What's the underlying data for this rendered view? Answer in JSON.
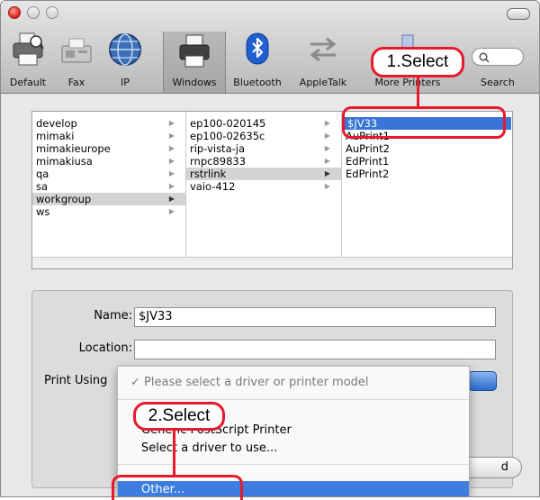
{
  "window": {
    "colors": {
      "selection": "#3875d7",
      "callout": "#e8192a",
      "menu_highlight": "#3d7ce0"
    }
  },
  "toolbar": {
    "items": [
      {
        "label": "Default",
        "icon": "printer-icon"
      },
      {
        "label": "Fax",
        "icon": "fax-icon"
      },
      {
        "label": "IP",
        "icon": "globe-icon"
      },
      {
        "label": "Windows",
        "icon": "windows-printer-icon",
        "selected": true
      },
      {
        "label": "Bluetooth",
        "icon": "bluetooth-icon"
      },
      {
        "label": "AppleTalk",
        "icon": "appletalk-arrows-icon"
      },
      {
        "label": "More Printers",
        "icon": "more-printers-icon"
      }
    ],
    "search_label": "Search"
  },
  "browser": {
    "col1": [
      "develop",
      "mimaki",
      "mimakieurope",
      "mimakiusa",
      "qa",
      "sa",
      "workgroup",
      "ws"
    ],
    "col1_selected": "workgroup",
    "col2": [
      "ep100-020145",
      "ep100-02635c",
      "rip-vista-ja",
      "rnpc89833",
      "rstrlink",
      "vaio-412"
    ],
    "col2_selected": "rstrlink",
    "col3": [
      "$JV33",
      "AuPrint1",
      "AuPrint2",
      "EdPrint1",
      "EdPrint2"
    ],
    "col3_selected": "$JV33"
  },
  "form": {
    "name_label": "Name:",
    "name_value": "$JV33",
    "location_label": "Location:",
    "location_value": "",
    "print_using_label": "Print Using"
  },
  "dropdown": {
    "placeholder_item": "Please select a driver or printer model",
    "check_mark": "✓",
    "items": [
      "Generic PostScript Printer",
      "Select a driver to use...",
      "Other..."
    ],
    "highlighted": "Other..."
  },
  "add_button_label": "d",
  "callouts": {
    "first": "1.Select",
    "second": "2.Select"
  }
}
